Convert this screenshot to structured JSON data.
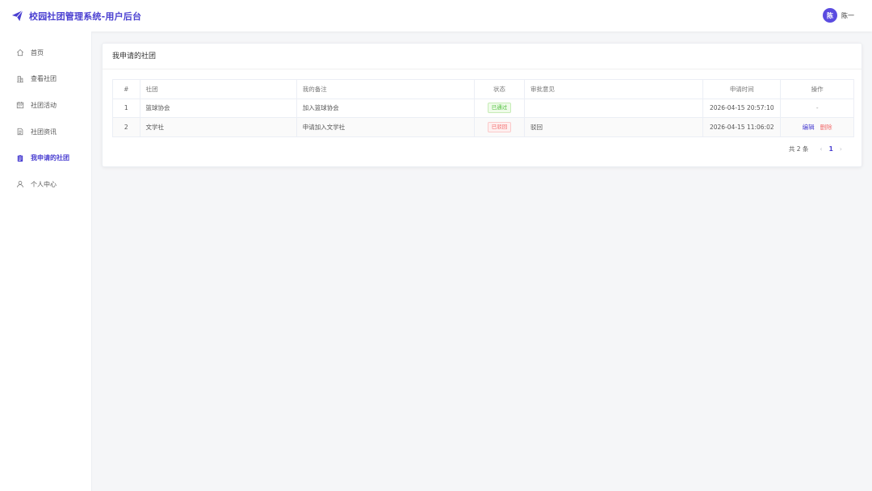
{
  "header": {
    "title": "校园社团管理系统-用户后台",
    "avatar_text": "陈",
    "username": "陈一",
    "accent": "#4a3fd1"
  },
  "sidebar": {
    "items": [
      {
        "label": "首页",
        "icon": "home-icon",
        "active": false
      },
      {
        "label": "查看社团",
        "icon": "building-icon",
        "active": false
      },
      {
        "label": "社团活动",
        "icon": "calendar-icon",
        "active": false
      },
      {
        "label": "社团资讯",
        "icon": "document-icon",
        "active": false
      },
      {
        "label": "我申请的社团",
        "icon": "clipboard-icon",
        "active": true
      },
      {
        "label": "个人中心",
        "icon": "user-icon",
        "active": false
      }
    ]
  },
  "main": {
    "card_title": "我申请的社团",
    "table": {
      "columns": [
        "#",
        "社团",
        "我的备注",
        "状态",
        "审批意见",
        "申请时间",
        "操作"
      ],
      "rows": [
        {
          "index": "1",
          "club": "篮球协会",
          "note": "加入篮球协会",
          "status": "已通过",
          "status_type": "approved",
          "opinion": "",
          "time": "2026-04-15 20:57:10",
          "action": "-"
        },
        {
          "index": "2",
          "club": "文学社",
          "note": "申请加入文学社",
          "status": "已驳回",
          "status_type": "rejected",
          "opinion": "驳回",
          "time": "2026-04-15 11:06:02",
          "edit_label": "编辑",
          "delete_label": "删除"
        }
      ]
    },
    "pagination": {
      "total_text": "共 2 条",
      "current_page": "1",
      "prev_icon": "chevron-left-icon",
      "next_icon": "chevron-right-icon"
    }
  }
}
